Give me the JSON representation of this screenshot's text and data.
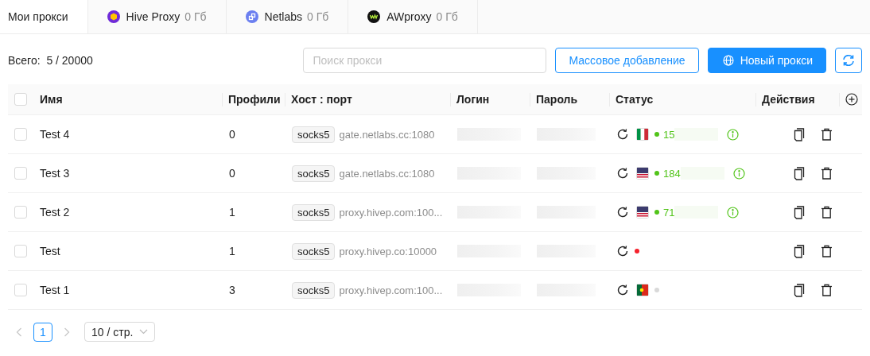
{
  "tabs": [
    {
      "label": "Мои прокси",
      "selected": true
    },
    {
      "label": "Hive Proxy",
      "usage": "0 Гб",
      "selected": false,
      "kind": "hive"
    },
    {
      "label": "Netlabs",
      "usage": "0 Гб",
      "selected": false,
      "kind": "netlabs"
    },
    {
      "label": "AWproxy",
      "usage": "0 Гб",
      "selected": false,
      "kind": "aw"
    }
  ],
  "total": {
    "label": "Всего:",
    "value": "5 / 20000"
  },
  "search": {
    "placeholder": "Поиск прокси"
  },
  "buttons": {
    "bulk_add": "Массовое добавление",
    "new_proxy": "Новый прокси"
  },
  "table": {
    "select_all": {
      "checked": false
    },
    "columns": [
      "Имя",
      "Профили",
      "Хост : порт",
      "Логин",
      "Пароль",
      "Статус",
      "Действия"
    ],
    "rows": [
      {
        "checked": false,
        "name": "Test 4",
        "profiles": "0",
        "protocol": "socks5",
        "host": "gate.netlabs.cc:1080",
        "flag": {
          "kind": "it"
        },
        "color": "#52c41a",
        "ip": "15",
        "info": true
      },
      {
        "checked": false,
        "name": "Test 3",
        "profiles": "0",
        "protocol": "socks5",
        "host": "gate.netlabs.cc:1080",
        "flag": {
          "kind": "us"
        },
        "color": "#52c41a",
        "ip": "184",
        "info": true
      },
      {
        "checked": false,
        "name": "Test 2",
        "profiles": "1",
        "protocol": "socks5",
        "host": "proxy.hivep.com:100...",
        "flag": {
          "kind": "us"
        },
        "color": "#52c41a",
        "ip": "71",
        "info": true
      },
      {
        "checked": false,
        "name": "Test",
        "profiles": "1",
        "protocol": "socks5",
        "host": "proxy.hivep.co:10000",
        "color": "#f5222d",
        "info": false
      },
      {
        "checked": false,
        "name": "Test 1",
        "profiles": "3",
        "protocol": "socks5",
        "host": "proxy.hivep.com:100...",
        "flag": {
          "kind": "pt"
        },
        "color": "#d9d9d9",
        "info": false
      }
    ]
  },
  "pagination": {
    "pages": [
      {
        "label": "1",
        "selected": true
      }
    ],
    "page_size": "10 / стр."
  }
}
